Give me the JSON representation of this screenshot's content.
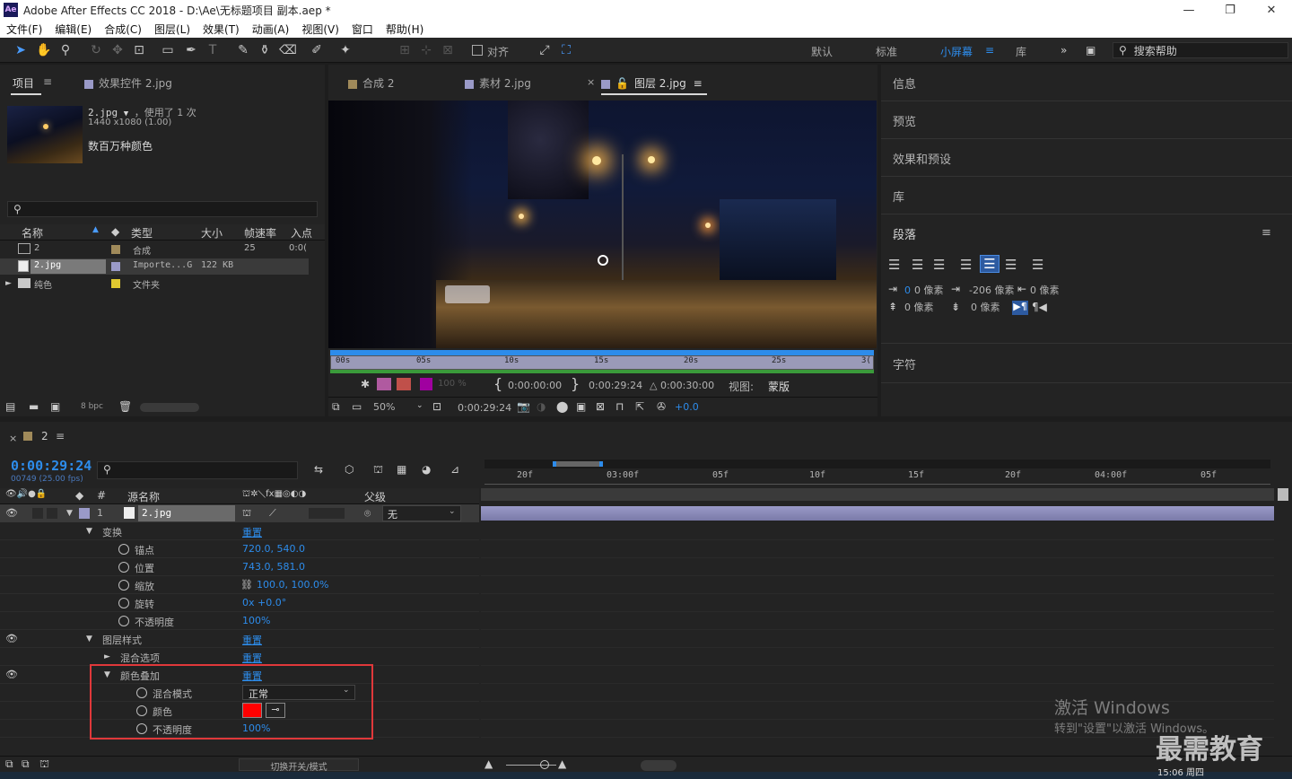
{
  "app": {
    "title": "Adobe After Effects CC 2018 - D:\\Ae\\无标题项目 副本.aep *",
    "logo": "Ae",
    "window_controls": [
      "—",
      "❐",
      "✕"
    ]
  },
  "menu": [
    "文件(F)",
    "编辑(E)",
    "合成(C)",
    "图层(L)",
    "效果(T)",
    "动画(A)",
    "视图(V)",
    "窗口",
    "帮助(H)"
  ],
  "toolbar": {
    "snap_label": "对齐",
    "workspaces": [
      "默认",
      "标准",
      "小屏幕",
      "库"
    ],
    "active_workspace": "小屏幕",
    "search_placeholder": "搜索帮助"
  },
  "project_panel": {
    "tab_project": "项目",
    "tab_effects": "效果控件 2.jpg",
    "item_name": "2.jpg",
    "item_usage": "，使用了 1 次",
    "item_dims": "1440 x1080 (1.00)",
    "item_color": "数百万种颜色",
    "columns": [
      "名称",
      "类型",
      "大小",
      "帧速率",
      "入点"
    ],
    "rows": [
      {
        "name": "2",
        "type": "合成",
        "size": "",
        "fps": "25",
        "in": "0:0(",
        "color": "#a08a5a"
      },
      {
        "name": "2.jpg",
        "type": "Importe...G",
        "size": "122 KB",
        "fps": "",
        "in": "",
        "color": "#9a9ac8"
      },
      {
        "name": "纯色",
        "type": "文件夹",
        "size": "",
        "fps": "",
        "in": "",
        "color": "#e0c830"
      }
    ],
    "bpc": "8 bpc"
  },
  "viewer": {
    "tabs": [
      "合成 2",
      "素材 2.jpg",
      "图层 2.jpg"
    ],
    "ruler_labels": [
      "00s",
      "05s",
      "10s",
      "15s",
      "20s",
      "25s",
      "3("
    ],
    "opacity": "100 %",
    "time_in": "0:00:00:00",
    "time_out": "0:00:29:24",
    "duration": "△ 0:00:30:00",
    "view_label": "视图:",
    "view_value": "蒙版",
    "zoom": "50%",
    "current_time": "0:00:29:24",
    "exposure": "+0.0"
  },
  "right_panel": {
    "sections": [
      "信息",
      "预览",
      "效果和预设",
      "库",
      "段落",
      "字符"
    ],
    "indent_left": "0 像素",
    "indent_first": "-206 像素",
    "indent_right": "0 像素",
    "space_before": "0 像素",
    "space_after": "0 像素"
  },
  "timeline": {
    "comp_name": "2",
    "current_time": "0:00:29:24",
    "frame_info": "00749 (25.00 fps)",
    "ruler_labels": [
      "20f",
      "03:00f",
      "05f",
      "10f",
      "15f",
      "20f",
      "04:00f",
      "05f"
    ],
    "col_source": "源名称",
    "col_parent": "父级",
    "layer_num": "1",
    "layer_name": "2.jpg",
    "parent_value": "无",
    "props": [
      {
        "label": "变换",
        "value": "重置",
        "indent": 1,
        "twirl": "▼"
      },
      {
        "label": "锚点",
        "value": "720.0, 540.0",
        "indent": 2
      },
      {
        "label": "位置",
        "value": "743.0, 581.0",
        "indent": 2
      },
      {
        "label": "缩放",
        "value": "100.0, 100.0%",
        "indent": 2
      },
      {
        "label": "旋转",
        "value": "0x +0.0°",
        "indent": 2
      },
      {
        "label": "不透明度",
        "value": "100%",
        "indent": 2
      },
      {
        "label": "图层样式",
        "value": "重置",
        "indent": 1,
        "twirl": "▼"
      },
      {
        "label": "混合选项",
        "value": "重置",
        "indent": 2,
        "twirl": "►"
      },
      {
        "label": "颜色叠加",
        "value": "重置",
        "indent": 2,
        "twirl": "▼"
      },
      {
        "label": "混合模式",
        "value": "正常",
        "indent": 3
      },
      {
        "label": "颜色",
        "value": "",
        "indent": 3
      },
      {
        "label": "不透明度",
        "value": "100%",
        "indent": 3
      }
    ],
    "overlay_color": "#ff0000",
    "toggle_label": "切换开关/模式"
  },
  "watermark": {
    "line1": "激活 Windows",
    "line2": "转到\"设置\"以激活 Windows。",
    "brand": "最需教育"
  },
  "taskbar_clock": "15:06 周四"
}
